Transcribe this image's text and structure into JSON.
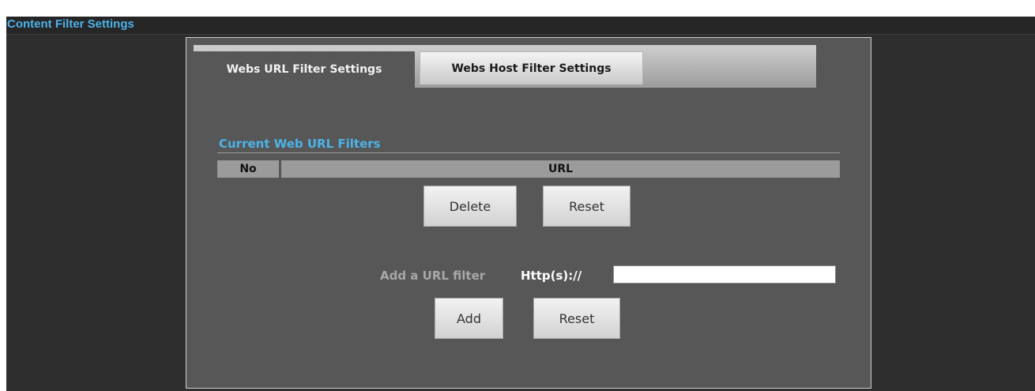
{
  "page": {
    "title": "Content Filter Settings"
  },
  "tabs": [
    {
      "label": "Webs URL Filter Settings",
      "active": true
    },
    {
      "label": "Webs Host Filter Settings",
      "active": false
    }
  ],
  "current_filters": {
    "title": "Current Web URL Filters",
    "columns": [
      "No",
      "URL"
    ],
    "rows": [],
    "delete_label": "Delete",
    "reset_label": "Reset"
  },
  "add_filter": {
    "label": "Add a URL filter",
    "prefix": "Http(s)://",
    "value": "",
    "add_label": "Add",
    "reset_label": "Reset"
  },
  "colors": {
    "accent": "#4cb3e9",
    "background": "#2e2e2e",
    "panel": "#575757"
  }
}
